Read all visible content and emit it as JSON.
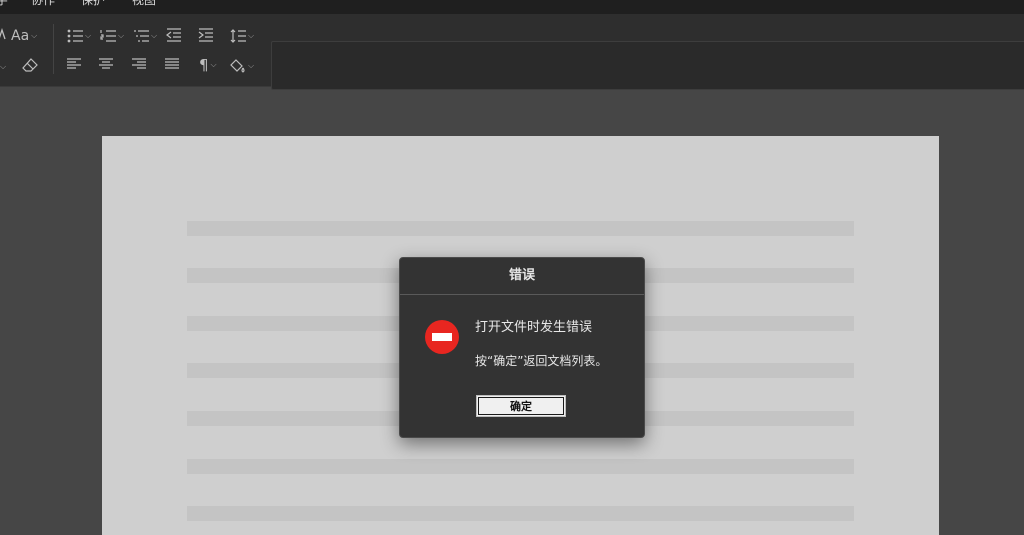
{
  "menu": {
    "items": [
      "字",
      "协作",
      "保护",
      "视图"
    ]
  },
  "toolbar": {
    "font_case_label": "Aa"
  },
  "dialog": {
    "title": "错误",
    "message": "打开文件时发生错误",
    "instruction": "按“确定”返回文档列表。",
    "ok_label": "确定",
    "icon": "error-stop-icon"
  },
  "colors": {
    "error_icon": "#e82620",
    "background": "#464646",
    "dialog": "#333333"
  }
}
